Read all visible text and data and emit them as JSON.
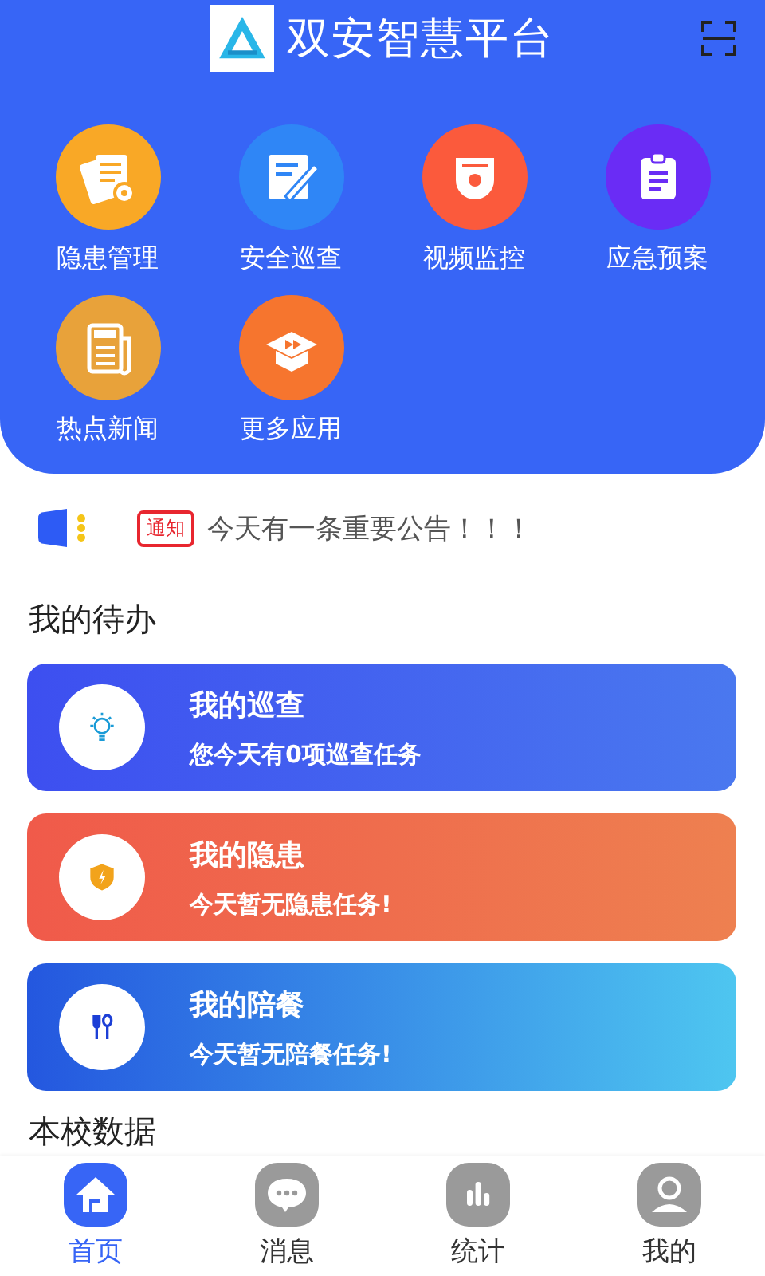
{
  "header": {
    "title": "双安智慧平台"
  },
  "features": [
    {
      "label": "隐患管理",
      "kind": "docs",
      "color": "#f9a826"
    },
    {
      "label": "安全巡查",
      "kind": "edit",
      "color": "#2f86f6"
    },
    {
      "label": "视频监控",
      "kind": "camera",
      "color": "#fb5a3c"
    },
    {
      "label": "应急预案",
      "kind": "clipboard",
      "color": "#6a2cf5"
    },
    {
      "label": "热点新闻",
      "kind": "news",
      "color": "#e8a23a"
    },
    {
      "label": "更多应用",
      "kind": "more",
      "color": "#f6752e"
    }
  ],
  "notice": {
    "badge": "通知",
    "text": "今天有一条重要公告！！！"
  },
  "todo": {
    "title": "我的待办",
    "cards": [
      {
        "title": "我的巡查",
        "subtitle": "您今天有0项巡查任务",
        "kind": "patrol"
      },
      {
        "title": "我的隐患",
        "subtitle": "今天暂无隐患任务!",
        "kind": "hazard"
      },
      {
        "title": "我的陪餐",
        "subtitle": "今天暂无陪餐任务!",
        "kind": "meal"
      }
    ]
  },
  "school_data": {
    "title": "本校数据"
  },
  "tabs": [
    {
      "label": "首页",
      "kind": "home",
      "selected": true
    },
    {
      "label": "消息",
      "kind": "message",
      "selected": false
    },
    {
      "label": "统计",
      "kind": "stats",
      "selected": false
    },
    {
      "label": "我的",
      "kind": "profile",
      "selected": false
    }
  ]
}
